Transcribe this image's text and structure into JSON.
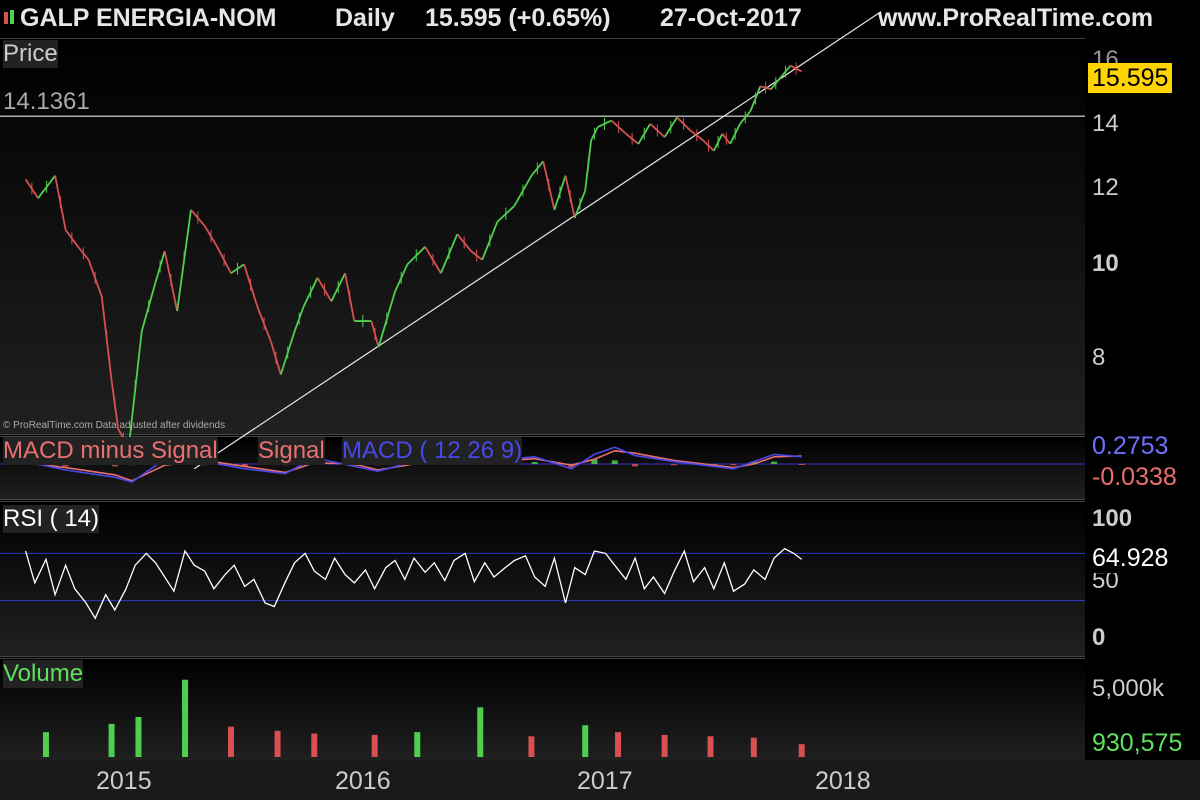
{
  "header": {
    "instrument": "GALP ENERGIA-NOM",
    "period": "Daily",
    "quote": "15.595 (+0.65%)",
    "date": "27-Oct-2017",
    "site": "www.ProRealTime.com"
  },
  "colors": {
    "up": "#4fcf4f",
    "down": "#d85050",
    "macd": "#4848e8",
    "signal": "#e87070",
    "price_box": "#ffd400",
    "volume_label": "#5fe05f"
  },
  "chart_data": [
    {
      "type": "line",
      "panel": "price",
      "title": "Price",
      "horizontal_line": 14.1361,
      "horizontal_line_label": "14.1361",
      "last_value": 15.595,
      "last_value_label": "15.595",
      "y_ticks": [
        "16",
        "14",
        "12",
        "10",
        "8"
      ],
      "y_tick_values": [
        16,
        14,
        12,
        10,
        8
      ],
      "x_ticks": [
        "2015",
        "2016",
        "2017",
        "2018"
      ],
      "x_tick_dates": [
        "2015-01-01",
        "2016-01-01",
        "2017-01-01",
        "2018-01-01"
      ],
      "footnote": "© ProRealTime.com  Data adjusted after dividends",
      "trendline": {
        "x": [
          "2015-04-15",
          "2018-02-25"
        ],
        "y": [
          6.5,
          17.8
        ]
      },
      "series": [
        {
          "x": [
            "2014-08-01",
            "2014-08-20",
            "2014-09-15",
            "2014-10-01",
            "2014-10-20",
            "2014-11-05",
            "2014-11-25",
            "2014-12-10",
            "2014-12-20",
            "2015-01-05",
            "2015-01-25",
            "2015-02-15",
            "2015-03-01",
            "2015-03-20",
            "2015-04-10",
            "2015-05-01",
            "2015-05-20",
            "2015-06-10",
            "2015-06-30",
            "2015-07-20",
            "2015-08-10",
            "2015-08-25",
            "2015-09-15",
            "2015-09-29",
            "2015-10-20",
            "2015-11-10",
            "2015-12-01",
            "2015-12-15",
            "2016-01-10",
            "2016-01-21",
            "2016-02-15",
            "2016-03-05",
            "2016-04-01",
            "2016-04-25",
            "2016-05-20",
            "2016-06-10",
            "2016-06-27",
            "2016-07-20",
            "2016-08-15",
            "2016-09-10",
            "2016-09-28",
            "2016-10-15",
            "2016-11-01",
            "2016-11-15",
            "2016-12-01",
            "2016-12-10",
            "2016-12-20",
            "2017-01-10",
            "2017-02-01",
            "2017-02-20",
            "2017-03-10",
            "2017-04-01",
            "2017-04-20",
            "2017-05-10",
            "2017-05-30",
            "2017-06-15",
            "2017-06-28",
            "2017-07-10",
            "2017-07-25",
            "2017-08-10",
            "2017-08-25",
            "2017-09-10",
            "2017-09-25",
            "2017-10-10",
            "2017-10-27"
          ],
          "values": [
            12.3,
            11.8,
            12.4,
            11.0,
            10.6,
            10.3,
            9.5,
            7.9,
            7.1,
            6.8,
            8.8,
            9.8,
            10.5,
            9.2,
            11.5,
            11.1,
            10.6,
            10.0,
            10.2,
            9.3,
            8.6,
            8.0,
            8.8,
            9.3,
            9.9,
            9.4,
            10.0,
            9.0,
            9.0,
            8.5,
            9.6,
            10.2,
            10.6,
            10.0,
            10.9,
            10.5,
            10.3,
            11.2,
            11.6,
            12.4,
            12.8,
            11.5,
            12.4,
            11.3,
            12.0,
            13.4,
            13.8,
            14.0,
            13.6,
            13.3,
            13.9,
            13.5,
            14.1,
            13.7,
            13.4,
            13.1,
            13.6,
            13.3,
            13.9,
            14.3,
            15.1,
            15.0,
            15.4,
            15.8,
            15.6
          ]
        }
      ]
    },
    {
      "type": "bar",
      "panel": "macd",
      "title": "MACD minus Signal",
      "title_parts": [
        "MACD minus Signal",
        "Signal",
        "MACD ( 12 26 9)"
      ],
      "last_value_labels": [
        "0.2753",
        "-0.0338"
      ],
      "x": [
        "2014-08-01",
        "2014-10-01",
        "2014-12-15",
        "2015-01-10",
        "2015-03-01",
        "2015-05-01",
        "2015-07-01",
        "2015-09-01",
        "2015-10-15",
        "2015-12-15",
        "2016-01-20",
        "2016-03-15",
        "2016-05-15",
        "2016-07-15",
        "2016-09-15",
        "2016-11-10",
        "2016-12-15",
        "2017-01-15",
        "2017-02-15",
        "2017-04-15",
        "2017-06-15",
        "2017-07-15",
        "2017-08-15",
        "2017-09-15",
        "2017-10-27"
      ],
      "series": [
        {
          "name": "MACD",
          "values": [
            0.1,
            -0.25,
            -0.55,
            -0.75,
            0.2,
            0.1,
            -0.2,
            -0.4,
            0.25,
            -0.1,
            -0.3,
            0.1,
            0.2,
            0.15,
            0.3,
            -0.2,
            0.4,
            0.7,
            0.35,
            0.1,
            -0.1,
            -0.2,
            0.1,
            0.4,
            0.3
          ]
        },
        {
          "name": "Signal",
          "values": [
            0.05,
            -0.15,
            -0.45,
            -0.7,
            -0.05,
            0.15,
            -0.1,
            -0.35,
            0.05,
            0.0,
            -0.25,
            0.0,
            0.15,
            0.1,
            0.22,
            -0.05,
            0.2,
            0.55,
            0.45,
            0.15,
            -0.05,
            -0.15,
            0.0,
            0.3,
            0.33
          ]
        },
        {
          "name": "MACD minus Signal",
          "values": [
            0.05,
            -0.1,
            -0.1,
            -0.05,
            0.25,
            -0.05,
            -0.1,
            -0.05,
            0.2,
            -0.1,
            -0.05,
            0.1,
            0.05,
            0.05,
            0.08,
            -0.15,
            0.2,
            0.15,
            -0.1,
            -0.05,
            -0.05,
            -0.05,
            0.1,
            0.1,
            -0.03
          ]
        }
      ]
    },
    {
      "type": "line",
      "panel": "rsi",
      "title": "RSI ( 14)",
      "y_ticks": [
        "100",
        "50",
        "0"
      ],
      "y_tick_values": [
        100,
        50,
        0
      ],
      "levels": [
        70,
        30
      ],
      "last_value": 64.928,
      "last_value_label": "64.928",
      "series": [
        {
          "name": "RSI ( 14)",
          "x": [
            "2014-08-01",
            "2014-08-15",
            "2014-09-01",
            "2014-09-15",
            "2014-10-01",
            "2014-10-15",
            "2014-11-01",
            "2014-11-15",
            "2014-12-01",
            "2014-12-15",
            "2015-01-01",
            "2015-01-15",
            "2015-02-01",
            "2015-02-15",
            "2015-03-01",
            "2015-03-15",
            "2015-04-01",
            "2015-04-15",
            "2015-05-01",
            "2015-05-15",
            "2015-06-01",
            "2015-06-15",
            "2015-07-01",
            "2015-07-15",
            "2015-08-01",
            "2015-08-15",
            "2015-09-01",
            "2015-09-15",
            "2015-10-01",
            "2015-10-15",
            "2015-11-01",
            "2015-11-15",
            "2015-12-01",
            "2015-12-15",
            "2016-01-01",
            "2016-01-15",
            "2016-02-01",
            "2016-02-15",
            "2016-03-01",
            "2016-03-15",
            "2016-04-01",
            "2016-04-15",
            "2016-05-01",
            "2016-05-15",
            "2016-06-01",
            "2016-06-15",
            "2016-07-01",
            "2016-07-15",
            "2016-08-01",
            "2016-08-15",
            "2016-09-01",
            "2016-09-15",
            "2016-10-01",
            "2016-10-15",
            "2016-11-01",
            "2016-11-15",
            "2016-12-01",
            "2016-12-15",
            "2017-01-01",
            "2017-01-15",
            "2017-02-01",
            "2017-02-15",
            "2017-03-01",
            "2017-03-15",
            "2017-04-01",
            "2017-04-15",
            "2017-05-01",
            "2017-05-15",
            "2017-06-01",
            "2017-06-15",
            "2017-07-01",
            "2017-07-15",
            "2017-08-01",
            "2017-08-15",
            "2017-09-01",
            "2017-09-15",
            "2017-10-01",
            "2017-10-15",
            "2017-10-27"
          ],
          "values": [
            72,
            45,
            65,
            35,
            60,
            40,
            28,
            15,
            35,
            22,
            40,
            60,
            70,
            62,
            50,
            38,
            72,
            60,
            55,
            40,
            52,
            60,
            42,
            48,
            28,
            25,
            46,
            62,
            70,
            55,
            48,
            66,
            52,
            45,
            56,
            40,
            58,
            64,
            48,
            66,
            54,
            62,
            47,
            64,
            70,
            46,
            62,
            50,
            58,
            64,
            68,
            50,
            42,
            66,
            28,
            58,
            52,
            72,
            70,
            60,
            48,
            66,
            40,
            50,
            36,
            54,
            72,
            46,
            58,
            40,
            62,
            38,
            44,
            56,
            48,
            66,
            74,
            70,
            64.9
          ]
        }
      ]
    },
    {
      "type": "bar",
      "panel": "volume",
      "title": "Volume",
      "y_ticks": [
        "5,000k"
      ],
      "y_tick_values": [
        5000000
      ],
      "last_value": 930575,
      "last_value_label": "930,575",
      "x": [
        "2014-09-01",
        "2014-12-10",
        "2015-01-20",
        "2015-04-01",
        "2015-06-10",
        "2015-08-20",
        "2015-10-15",
        "2016-01-15",
        "2016-03-20",
        "2016-06-24",
        "2016-09-10",
        "2016-12-01",
        "2017-01-20",
        "2017-04-01",
        "2017-06-10",
        "2017-08-15",
        "2017-10-27"
      ],
      "series": [
        {
          "name": "Volume",
          "values": [
            1800000,
            2400000,
            2900000,
            5600000,
            2200000,
            1900000,
            1700000,
            1600000,
            1800000,
            3600000,
            1500000,
            2300000,
            1800000,
            1600000,
            1500000,
            1400000,
            930575
          ]
        }
      ]
    }
  ]
}
